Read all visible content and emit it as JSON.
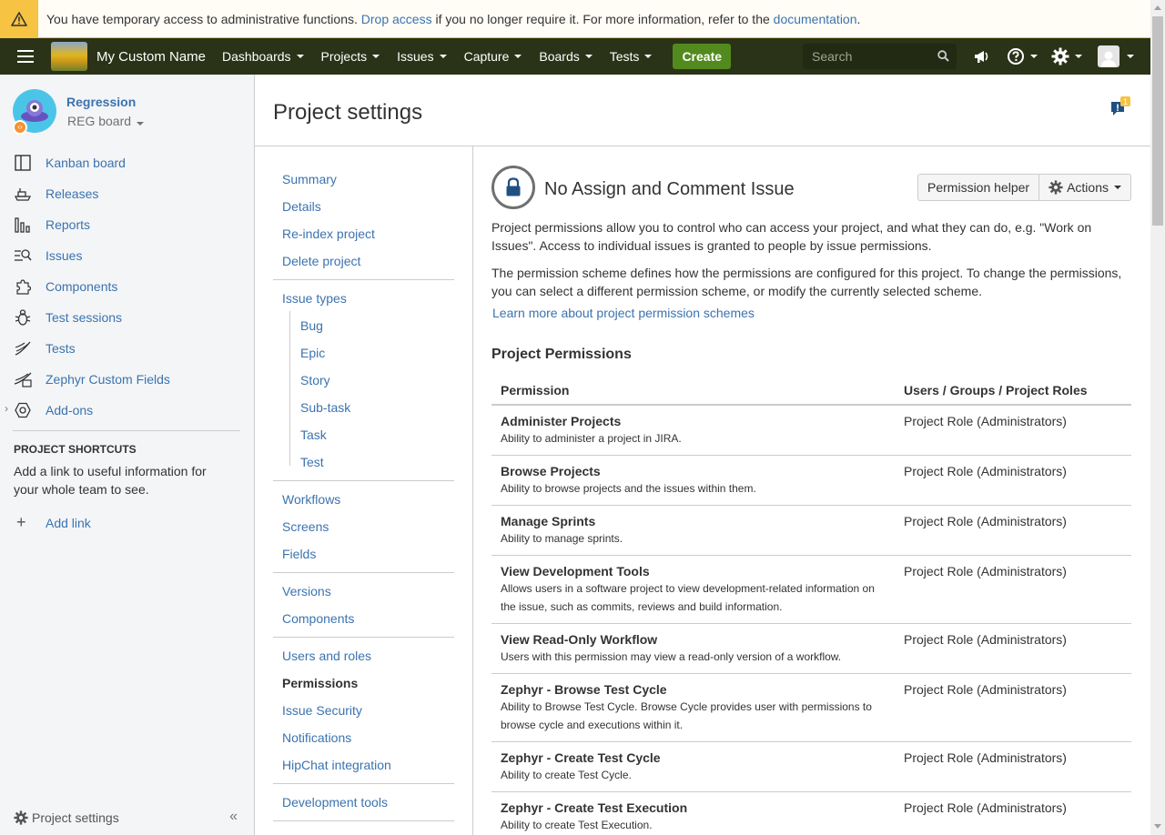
{
  "banner": {
    "text_before": "You have temporary access to administrative functions. ",
    "drop_access": "Drop access",
    "text_middle": " if you no longer require it. For more information, refer to the ",
    "documentation": "documentation",
    "text_after": "."
  },
  "topnav": {
    "brand": "My Custom Name",
    "items": [
      "Dashboards",
      "Projects",
      "Issues",
      "Capture",
      "Boards",
      "Tests"
    ],
    "create": "Create",
    "search_placeholder": "Search"
  },
  "sidebar": {
    "project_name": "Regression",
    "board_name": "REG board",
    "items": [
      {
        "label": "Kanban board",
        "icon": "kanban-board-icon"
      },
      {
        "label": "Releases",
        "icon": "releases-icon"
      },
      {
        "label": "Reports",
        "icon": "reports-icon"
      },
      {
        "label": "Issues",
        "icon": "issues-icon"
      },
      {
        "label": "Components",
        "icon": "components-icon"
      },
      {
        "label": "Test sessions",
        "icon": "test-sessions-icon"
      },
      {
        "label": "Tests",
        "icon": "tests-icon"
      },
      {
        "label": "Zephyr Custom Fields",
        "icon": "zephyr-custom-fields-icon"
      },
      {
        "label": "Add-ons",
        "icon": "add-ons-icon"
      }
    ],
    "shortcuts_title": "PROJECT SHORTCUTS",
    "shortcuts_text": "Add a link to useful information for your whole team to see.",
    "add_link": "Add link",
    "footer": "Project settings"
  },
  "page": {
    "title": "Project settings",
    "feedback_count": "1"
  },
  "settings_nav": {
    "group1": [
      "Summary",
      "Details",
      "Re-index project",
      "Delete project"
    ],
    "issue_types": "Issue types",
    "issue_type_items": [
      "Bug",
      "Epic",
      "Story",
      "Sub-task",
      "Task",
      "Test"
    ],
    "group3": [
      "Workflows",
      "Screens",
      "Fields"
    ],
    "group4": [
      "Versions",
      "Components"
    ],
    "group5": [
      "Users and roles",
      "Permissions",
      "Issue Security",
      "Notifications",
      "HipChat integration"
    ],
    "group6": [
      "Development tools"
    ],
    "active": "Permissions"
  },
  "main": {
    "scheme_title": "No Assign and Comment Issue",
    "permission_helper": "Permission helper",
    "actions": "Actions",
    "desc1": "Project permissions allow you to control who can access your project, and what they can do, e.g. \"Work on Issues\". Access to individual issues is granted to people by issue permissions.",
    "desc2": "The permission scheme defines how the permissions are configured for this project. To change the permissions, you can select a different permission scheme, or modify the currently selected scheme.",
    "learn_more": "Learn more about project permission schemes",
    "section_title": "Project Permissions",
    "table_headers": [
      "Permission",
      "Users / Groups / Project Roles"
    ],
    "permissions": [
      {
        "name": "Administer Projects",
        "desc": "Ability to administer a project in JIRA.",
        "roles": "Project Role (Administrators)"
      },
      {
        "name": "Browse Projects",
        "desc": "Ability to browse projects and the issues within them.",
        "roles": "Project Role (Administrators)"
      },
      {
        "name": "Manage Sprints",
        "desc": "Ability to manage sprints.",
        "roles": "Project Role (Administrators)"
      },
      {
        "name": "View Development Tools",
        "desc": "Allows users in a software project to view development-related information on the issue, such as commits, reviews and build information.",
        "roles": "Project Role (Administrators)"
      },
      {
        "name": "View Read-Only Workflow",
        "desc": "Users with this permission may view a read-only version of a workflow.",
        "roles": "Project Role (Administrators)"
      },
      {
        "name": "Zephyr - Browse Test Cycle",
        "desc": "Ability to Browse Test Cycle. Browse Cycle provides user with permissions to browse cycle and executions within it.",
        "roles": "Project Role (Administrators)"
      },
      {
        "name": "Zephyr - Create Test Cycle",
        "desc": "Ability to create Test Cycle.",
        "roles": "Project Role (Administrators)"
      },
      {
        "name": "Zephyr - Create Test Execution",
        "desc": "Ability to create Test Execution.",
        "roles": "Project Role (Administrators)"
      }
    ]
  }
}
